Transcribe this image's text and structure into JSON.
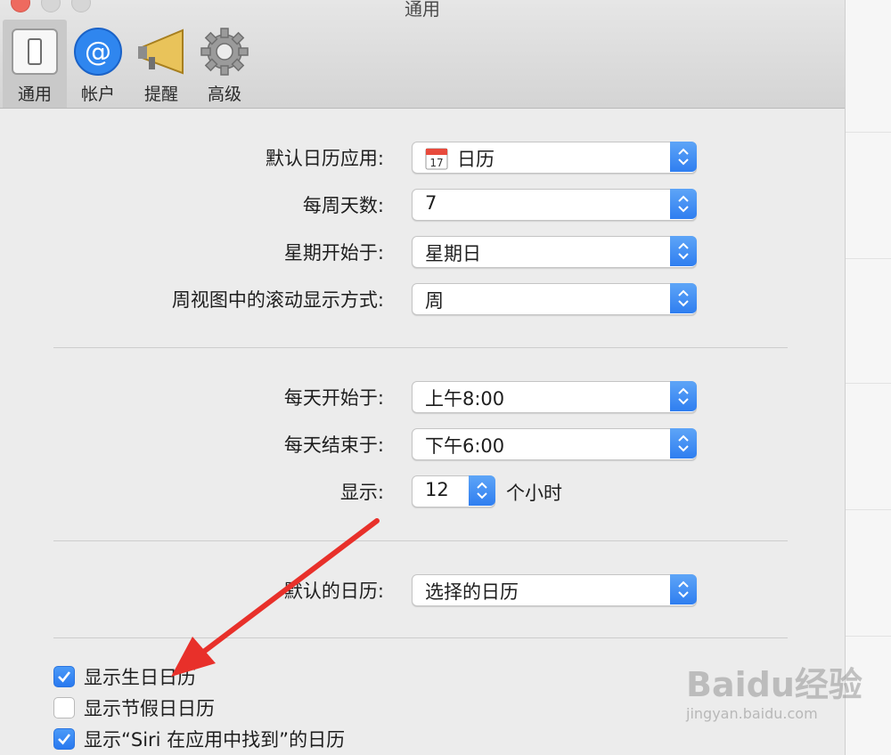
{
  "window": {
    "title": "通用"
  },
  "toolbar": {
    "tabs": [
      {
        "label": "通用",
        "icon": "general-icon",
        "selected": true
      },
      {
        "label": "帐户",
        "icon": "accounts-icon"
      },
      {
        "label": "提醒",
        "icon": "alerts-icon"
      },
      {
        "label": "高级",
        "icon": "advanced-icon"
      }
    ]
  },
  "general": {
    "default_calendar_app": {
      "label": "默认日历应用:",
      "value": "日历"
    },
    "days_per_week": {
      "label": "每周天数:",
      "value": "7"
    },
    "start_week_on": {
      "label": "星期开始于:",
      "value": "星期日"
    },
    "scroll_in_week_view": {
      "label": "周视图中的滚动显示方式:",
      "value": "周"
    },
    "day_starts_at": {
      "label": "每天开始于:",
      "value": "上午8:00"
    },
    "day_ends_at": {
      "label": "每天结束于:",
      "value": "下午6:00"
    },
    "show_hours": {
      "label": "显示:",
      "value": "12",
      "suffix": "个小时"
    },
    "default_calendar": {
      "label": "默认的日历:",
      "value": "选择的日历"
    }
  },
  "checkboxes": [
    {
      "label": "显示生日日历",
      "checked": true
    },
    {
      "label": "显示节假日日历",
      "checked": false
    },
    {
      "label": "显示“Siri 在应用中找到”的日历",
      "checked": true
    }
  ],
  "calendar_icon_day": "17",
  "watermark": {
    "logo": "Baidu经验",
    "url": "jingyan.baidu.com"
  },
  "colors": {
    "accent": "#2f7ef0",
    "arrow": "#e8302a"
  }
}
